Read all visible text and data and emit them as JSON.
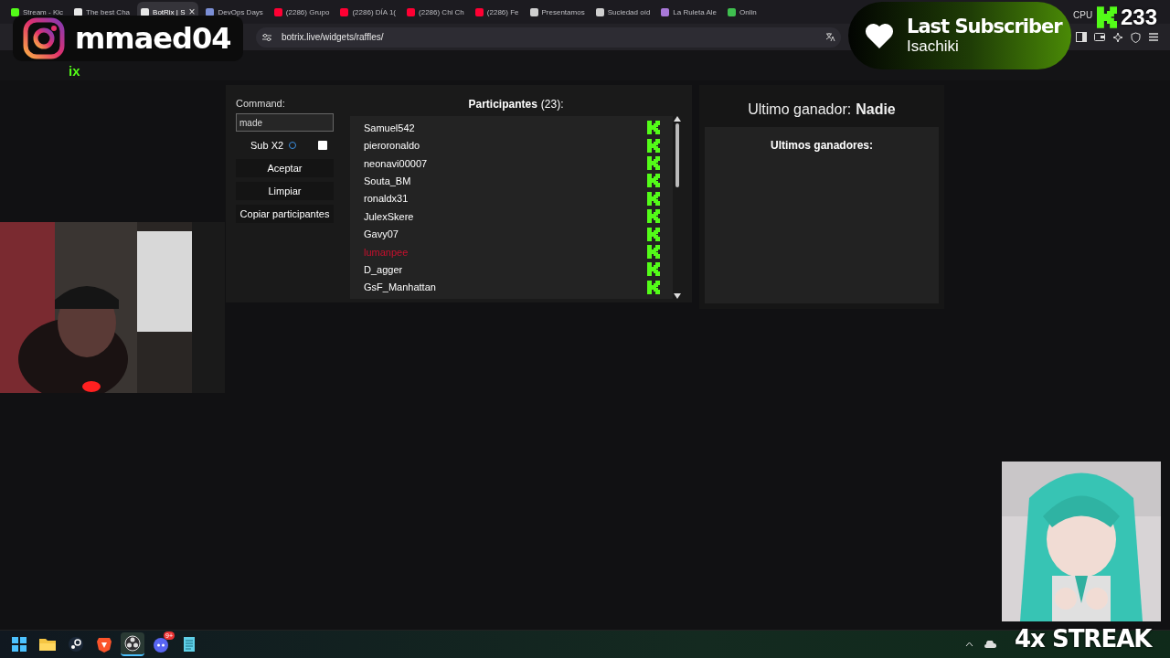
{
  "browser": {
    "tabs": [
      {
        "title": "Stream - Kic",
        "selected": false,
        "color": "#53fc18"
      },
      {
        "title": "The best Cha",
        "selected": false,
        "color": "#e8e8e8"
      },
      {
        "title": "BotRix | S",
        "selected": true,
        "color": "#e8e8e8"
      },
      {
        "title": "DevOps Days",
        "selected": false,
        "color": "#7b8fd6"
      },
      {
        "title": "(2286) Grupo",
        "selected": false,
        "color": "#ff0033"
      },
      {
        "title": "(2286) DÍA 1(",
        "selected": false,
        "color": "#ff0033"
      },
      {
        "title": "(2286) Chi Ch",
        "selected": false,
        "color": "#ff0033"
      },
      {
        "title": "(2286) Fe",
        "selected": false,
        "color": "#ff0033"
      },
      {
        "title": "Presentamos",
        "selected": false,
        "color": "#cfcfcf"
      },
      {
        "title": "Suciedad oíd",
        "selected": false,
        "color": "#cfcfcf"
      },
      {
        "title": "La Ruleta Ale",
        "selected": false,
        "color": "#a878d8"
      },
      {
        "title": "Onlin",
        "selected": false,
        "color": "#3fbf4f"
      }
    ],
    "close_glyph": "×",
    "url": "botrix.live/widgets/raffles/",
    "system_label": "CPU"
  },
  "site": {
    "logo_fragment": "ix"
  },
  "raffle": {
    "command_label": "Command:",
    "command_value": "made",
    "sub_x2": {
      "label": "Sub X2",
      "checked": false
    },
    "buttons": [
      "Aceptar",
      "Limpiar",
      "Copiar participantes"
    ],
    "participants_title": "Participantes",
    "participants_count": "(23):",
    "participants": [
      {
        "name": "Samuel542",
        "color": "#ffffff"
      },
      {
        "name": "pieroronaldo",
        "color": "#ffffff"
      },
      {
        "name": "neonavi00007",
        "color": "#ffffff"
      },
      {
        "name": "Souta_BM",
        "color": "#ffffff"
      },
      {
        "name": "ronaldx31",
        "color": "#ffffff"
      },
      {
        "name": "JulexSkere",
        "color": "#ffffff"
      },
      {
        "name": "Gavy07",
        "color": "#ffffff"
      },
      {
        "name": "lumanpee",
        "color": "#c8102e"
      },
      {
        "name": "D_agger",
        "color": "#ffffff"
      },
      {
        "name": "GsF_Manhattan",
        "color": "#ffffff"
      }
    ],
    "last_winner_label": "Ultimo ganador:",
    "last_winner": "Nadie",
    "winners_title": "Ultimos ganadores:"
  },
  "overlays": {
    "instagram_handle": "mmaed04",
    "subscriber_title": "Last Subscriber",
    "subscriber_name": "Isachiki",
    "viewer_count": "233",
    "streak": "4x STREAK"
  },
  "taskbar": {
    "apps": [
      {
        "kind": "start",
        "active": false
      },
      {
        "kind": "folder",
        "active": false
      },
      {
        "kind": "steam",
        "active": false
      },
      {
        "kind": "lion",
        "active": false
      },
      {
        "kind": "obs",
        "active": true
      },
      {
        "kind": "chat",
        "active": false,
        "badge": "9+"
      },
      {
        "kind": "notepad",
        "active": false
      }
    ]
  }
}
